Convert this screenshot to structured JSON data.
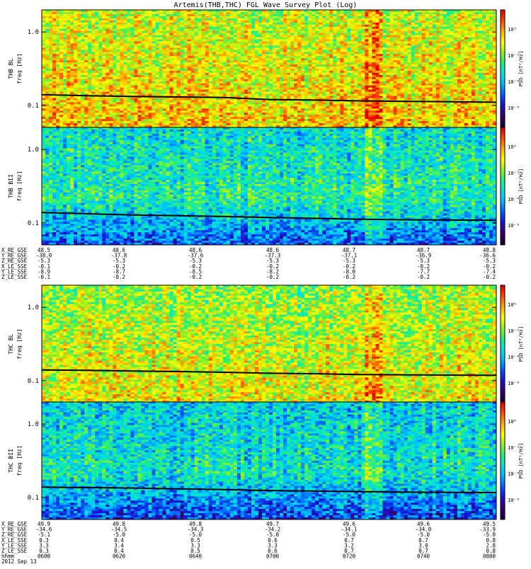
{
  "title": "Artemis(THB,THC) FGL Wave Survey Plot (Log)",
  "colors": {
    "trace": "#000000",
    "colormap": [
      "#1a0030",
      "#3a0068",
      "#1a10d0",
      "#0058ff",
      "#00b4ff",
      "#00e2e0",
      "#20f080",
      "#90f020",
      "#ffff00",
      "#ffb000",
      "#ff5000",
      "#e00000"
    ]
  },
  "chart_data": [
    {
      "type": "heatmap",
      "panel": "THB BL",
      "ylabel_probe": "THB BL",
      "ylabel_unit": "freq [Hz]",
      "ylim": [
        0.05,
        2.0
      ],
      "yscale": "log",
      "yticks": [
        "1.0",
        "0.1"
      ],
      "colorbar_label": "PSD [nT²/Hz]",
      "colorbar_ticks": [
        "10⁰",
        "10⁻²",
        "10⁻⁴",
        "10⁻⁶"
      ],
      "base_level": 0.78,
      "trace": {
        "x": [
          0,
          1,
          2,
          3,
          4,
          5,
          6,
          7,
          8,
          9,
          10
        ],
        "y": [
          0.14,
          0.135,
          0.132,
          0.13,
          0.128,
          0.12,
          0.118,
          0.115,
          0.113,
          0.112,
          0.11
        ]
      }
    },
    {
      "type": "heatmap",
      "panel": "THB BII",
      "ylabel_probe": "THB BII",
      "ylabel_unit": "freq [Hz]",
      "ylim": [
        0.05,
        2.0
      ],
      "yscale": "log",
      "yticks": [
        "1.0",
        "0.1"
      ],
      "colorbar_label": "PSD [nT²/Hz]",
      "colorbar_ticks": [
        "10⁰",
        "10⁻²",
        "10⁻⁴",
        "10⁻⁶"
      ],
      "base_level": 0.55,
      "trace": {
        "x": [
          0,
          1,
          2,
          3,
          4,
          5,
          6,
          7,
          8,
          9,
          10
        ],
        "y": [
          0.138,
          0.133,
          0.128,
          0.125,
          0.122,
          0.118,
          0.115,
          0.112,
          0.11,
          0.109,
          0.108
        ]
      }
    },
    {
      "type": "heatmap",
      "panel": "THC BL",
      "ylabel_probe": "THC BL",
      "ylabel_unit": "freq [Hz]",
      "ylim": [
        0.05,
        2.0
      ],
      "yscale": "log",
      "yticks": [
        "1.0",
        "0.1"
      ],
      "colorbar_label": "PSD [nT²/Hz]",
      "colorbar_ticks": [
        "10⁰",
        "10⁻²",
        "10⁻⁴",
        "10⁻⁶"
      ],
      "base_level": 0.74,
      "trace": {
        "x": [
          0,
          1,
          2,
          3,
          4,
          5,
          6,
          7,
          8,
          9,
          10
        ],
        "y": [
          0.14,
          0.138,
          0.135,
          0.133,
          0.13,
          0.126,
          0.124,
          0.121,
          0.12,
          0.119,
          0.118
        ]
      }
    },
    {
      "type": "heatmap",
      "panel": "THC BII",
      "ylabel_probe": "THC BII",
      "ylabel_unit": "freq [Hz]",
      "ylim": [
        0.05,
        2.0
      ],
      "yscale": "log",
      "yticks": [
        "1.0",
        "0.1"
      ],
      "colorbar_label": "PSD [nT²/Hz]",
      "colorbar_ticks": [
        "10⁰",
        "10⁻²",
        "10⁻⁴",
        "10⁻⁶"
      ],
      "base_level": 0.52,
      "trace": {
        "x": [
          0,
          1,
          2,
          3,
          4,
          5,
          6,
          7,
          8,
          9,
          10
        ],
        "y": [
          0.138,
          0.136,
          0.134,
          0.131,
          0.128,
          0.124,
          0.122,
          0.12,
          0.118,
          0.117,
          0.116
        ]
      }
    }
  ],
  "ephemeris_blocks": [
    {
      "rows": [
        {
          "label": "X_RE_GSE",
          "values": [
            "48.5",
            "48.6",
            "48.6",
            "48.6",
            "48.7",
            "48.7",
            "48.8"
          ]
        },
        {
          "label": "Y_RE_GSE",
          "values": [
            "-38.0",
            "-37.8",
            "-37.6",
            "-37.3",
            "-37.1",
            "-36.9",
            "-36.6"
          ]
        },
        {
          "label": "Z_RE_GSE",
          "values": [
            "-5.3",
            "-5.3",
            "-5.3",
            "-5.3",
            "-5.3",
            "-5.3",
            "-5.3"
          ]
        },
        {
          "label": "X_LE_SSE",
          "values": [
            "-0.1",
            "-0.2",
            "-0.2",
            "-0.2",
            "-0.2",
            "-0.2",
            "-0.2"
          ]
        },
        {
          "label": "Y_LE_SSE",
          "values": [
            "-8.9",
            "-8.7",
            "-8.5",
            "-8.2",
            "-8.0",
            "-7.7",
            "-7.4"
          ]
        },
        {
          "label": "Z_LE_SSE",
          "values": [
            "-0.1",
            "-0.2",
            "-0.2",
            "-0.2",
            "-0.2",
            "-0.2",
            "-0.2"
          ]
        }
      ]
    },
    {
      "rows": [
        {
          "label": "X_RE_GSE",
          "values": [
            "49.9",
            "49.8",
            "49.8",
            "49.7",
            "49.6",
            "49.6",
            "49.5"
          ]
        },
        {
          "label": "Y_RE_GSE",
          "values": [
            "-34.6",
            "-34.5",
            "-34.3",
            "-34.2",
            "-34.1",
            "-34.0",
            "-33.9"
          ]
        },
        {
          "label": "Z_RE_GSE",
          "values": [
            "-5.1",
            "-5.0",
            "-5.0",
            "-5.0",
            "-5.0",
            "-5.0",
            "-5.0"
          ]
        },
        {
          "label": "X_LE_SSE",
          "values": [
            "0.3",
            "0.4",
            "0.5",
            "0.6",
            "0.7",
            "0.7",
            "0.8"
          ]
        },
        {
          "label": "Y_LE_SSE",
          "values": [
            "3.3",
            "3.4",
            "3.3",
            "3.3",
            "3.2",
            "3.0",
            "2.8"
          ]
        },
        {
          "label": "Z_LE_SSE",
          "values": [
            "0.3",
            "0.4",
            "0.5",
            "0.6",
            "0.7",
            "0.7",
            "0.8"
          ]
        },
        {
          "label": "hhmm",
          "values": [
            "0600",
            "0620",
            "0640",
            "0700",
            "0720",
            "0740",
            "0800"
          ]
        }
      ],
      "footer": "2012 Sep 13"
    }
  ]
}
